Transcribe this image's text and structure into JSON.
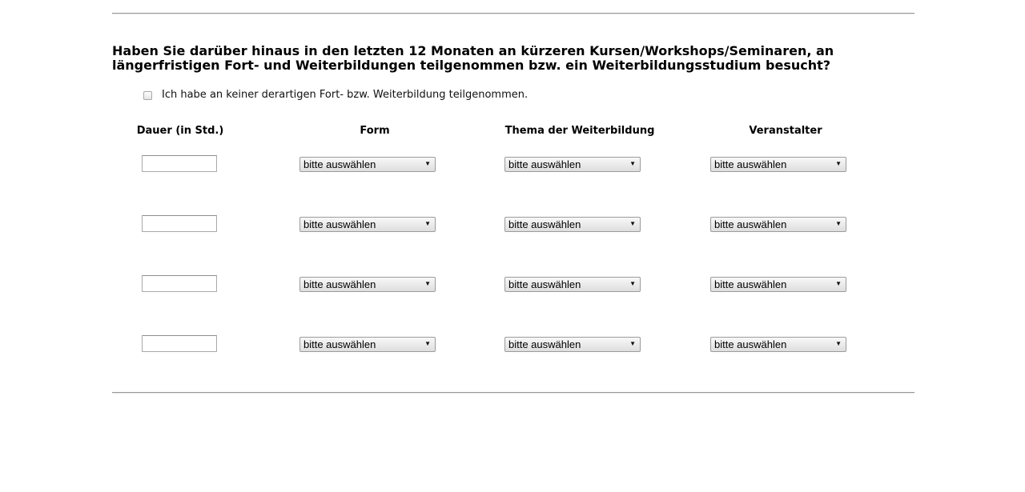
{
  "question": {
    "text": "Haben Sie darüber hinaus in den letzten 12 Monaten an kürzeren Kursen/Workshops/Seminaren, an längerfristigen Fort- und Weiterbildungen teilgenommen bzw. ein Weiterbildungsstudium besucht?"
  },
  "none_option": {
    "label": "Ich habe an keiner derartigen Fort- bzw. Weiterbildung teilgenommen.",
    "checked": false
  },
  "columns": {
    "duration": "Dauer (in Std.)",
    "form": "Form",
    "thema": "Thema der Weiterbildung",
    "veranstalter": "Veranstalter"
  },
  "rows": [
    {
      "duration": "",
      "form": "bitte auswählen",
      "thema": "bitte auswählen",
      "veranstalter": "bitte auswählen"
    },
    {
      "duration": "",
      "form": "bitte auswählen",
      "thema": "bitte auswählen",
      "veranstalter": "bitte auswählen"
    },
    {
      "duration": "",
      "form": "bitte auswählen",
      "thema": "bitte auswählen",
      "veranstalter": "bitte auswählen"
    },
    {
      "duration": "",
      "form": "bitte auswählen",
      "thema": "bitte auswählen",
      "veranstalter": "bitte auswählen"
    }
  ],
  "icons": {
    "dropdown": "dropdown-arrow-icon"
  }
}
